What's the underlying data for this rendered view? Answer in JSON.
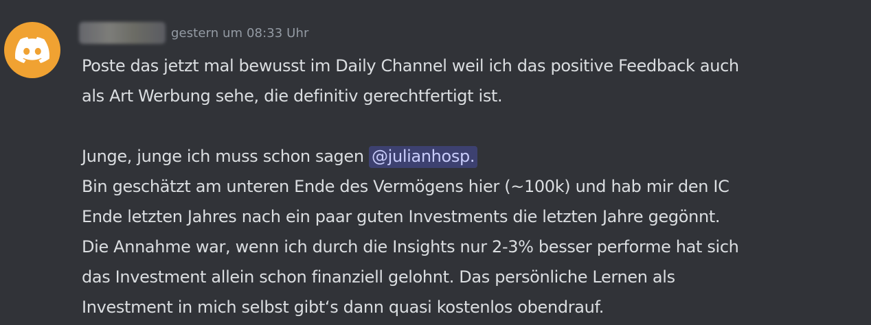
{
  "message": {
    "avatar": {
      "icon": "discord-logo-icon",
      "color": "#f0a232"
    },
    "author": {
      "username": "username",
      "redacted": true
    },
    "timestamp": "gestern um 08:33 Uhr",
    "paragraph1": {
      "line1": "Poste das jetzt mal bewusst im Daily Channel weil ich das positive Feedback auch",
      "line2": "als Art Werbung sehe, die definitiv gerechtfertigt ist."
    },
    "paragraph2": {
      "line1_text": "Junge, junge ich muss schon sagen ",
      "mention": "@julianhosp.",
      "line2": "Bin geschätzt am unteren Ende des Vermögens hier (~100k) und hab mir den IC",
      "line3": "Ende letzten Jahres nach ein paar guten Investments die letzten Jahre gegönnt.",
      "line4": "Die Annahme war, wenn ich durch die Insights nur 2-3% besser performe hat sich",
      "line5": "das Investment allein schon finanziell gelohnt. Das persönliche Lernen als",
      "line6": "Investment in mich selbst gibt‘s dann quasi kostenlos obendrauf."
    }
  }
}
